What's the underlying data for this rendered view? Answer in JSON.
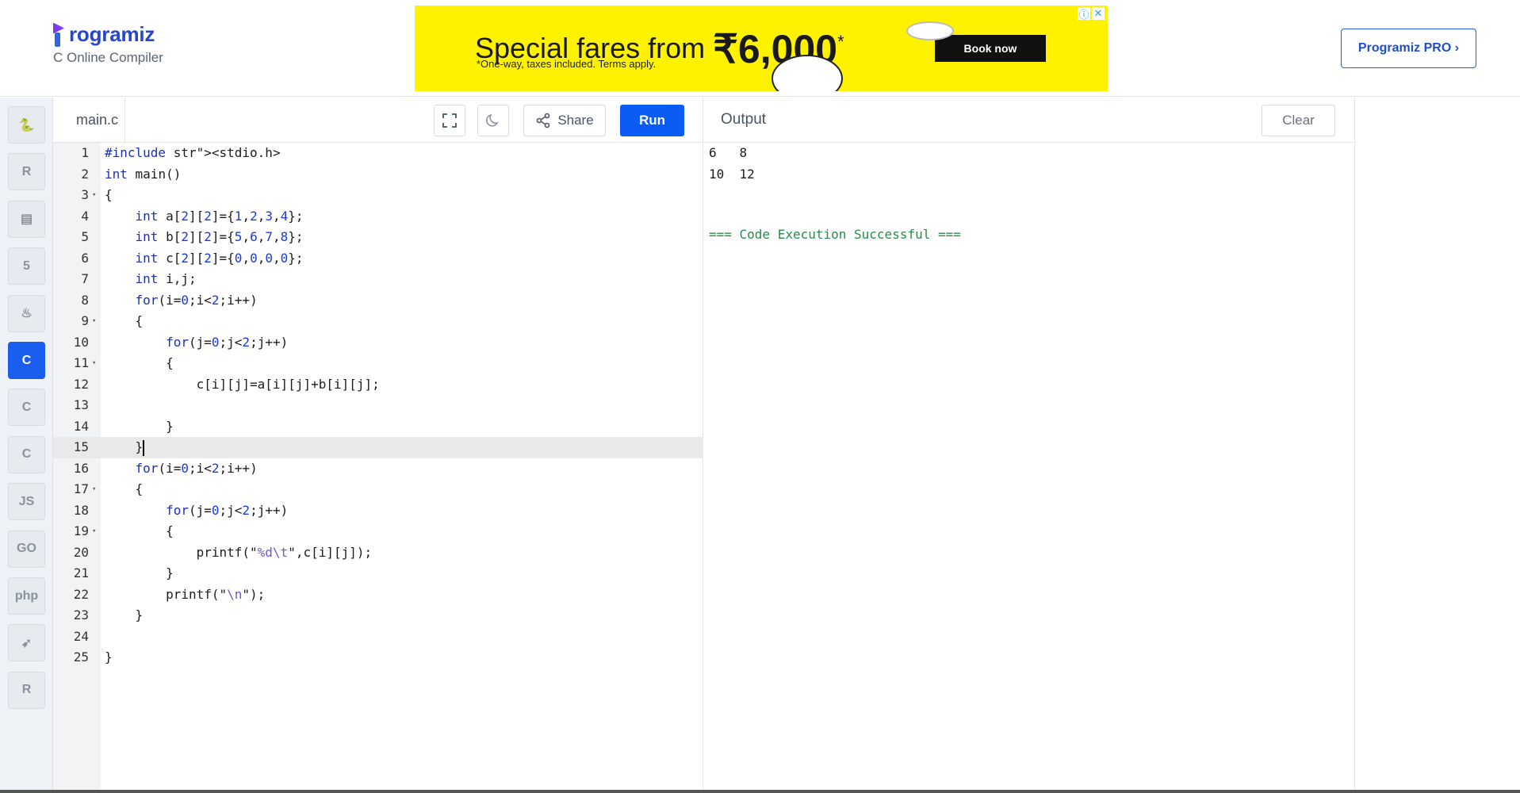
{
  "header": {
    "logo_text": "rogramiz",
    "logo_initial": "P",
    "subtitle": "C Online Compiler",
    "pro_button": "Programiz PRO ›"
  },
  "ad": {
    "headline": "Special fares from ",
    "price": "₹6,000",
    "price_mark": "*",
    "subline": "*One-way, taxes included. Terms apply.",
    "cta": "Book now",
    "info_icon": "ⓘ",
    "close_icon": "✕"
  },
  "rail": [
    {
      "name": "python",
      "glyph": "🐍",
      "active": false
    },
    {
      "name": "r",
      "glyph": "R",
      "active": false
    },
    {
      "name": "sql",
      "glyph": "▤",
      "active": false
    },
    {
      "name": "html",
      "glyph": "5",
      "active": false
    },
    {
      "name": "java",
      "glyph": "♨",
      "active": false
    },
    {
      "name": "c",
      "glyph": "C",
      "active": true
    },
    {
      "name": "cpp",
      "glyph": "C",
      "active": false
    },
    {
      "name": "csharp",
      "glyph": "C",
      "active": false
    },
    {
      "name": "js",
      "glyph": "JS",
      "active": false
    },
    {
      "name": "go",
      "glyph": "GO",
      "active": false
    },
    {
      "name": "php",
      "glyph": "php",
      "active": false
    },
    {
      "name": "swift",
      "glyph": "➶",
      "active": false
    },
    {
      "name": "rust",
      "glyph": "R",
      "active": false
    }
  ],
  "editor": {
    "filename": "main.c",
    "share_label": "Share",
    "run_label": "Run",
    "active_line": 15,
    "lines": [
      {
        "n": "1",
        "text": "#include <stdio.h>"
      },
      {
        "n": "2",
        "text": "int main()"
      },
      {
        "n": "3",
        "text": "{"
      },
      {
        "n": "4",
        "text": "    int a[2][2]={1,2,3,4};"
      },
      {
        "n": "5",
        "text": "    int b[2][2]={5,6,7,8};"
      },
      {
        "n": "6",
        "text": "    int c[2][2]={0,0,0,0};"
      },
      {
        "n": "7",
        "text": "    int i,j;"
      },
      {
        "n": "8",
        "text": "    for(i=0;i<2;i++)"
      },
      {
        "n": "9",
        "text": "    {"
      },
      {
        "n": "10",
        "text": "        for(j=0;j<2;j++)"
      },
      {
        "n": "11",
        "text": "        {"
      },
      {
        "n": "12",
        "text": "            c[i][j]=a[i][j]+b[i][j];"
      },
      {
        "n": "13",
        "text": ""
      },
      {
        "n": "14",
        "text": "        }"
      },
      {
        "n": "15",
        "text": "    }"
      },
      {
        "n": "16",
        "text": "    for(i=0;i<2;i++)"
      },
      {
        "n": "17",
        "text": "    {"
      },
      {
        "n": "18",
        "text": "        for(j=0;j<2;j++)"
      },
      {
        "n": "19",
        "text": "        {"
      },
      {
        "n": "20",
        "text": "            printf(\"%d\\t\",c[i][j]);"
      },
      {
        "n": "21",
        "text": "        }"
      },
      {
        "n": "22",
        "text": "        printf(\"\\n\");"
      },
      {
        "n": "23",
        "text": "    }"
      },
      {
        "n": "24",
        "text": ""
      },
      {
        "n": "25",
        "text": "}"
      }
    ],
    "fold_lines": [
      "3",
      "9",
      "11",
      "17",
      "19"
    ]
  },
  "output": {
    "title": "Output",
    "clear_label": "Clear",
    "text": "6   8\n10  12",
    "success": "=== Code Execution Successful ==="
  }
}
